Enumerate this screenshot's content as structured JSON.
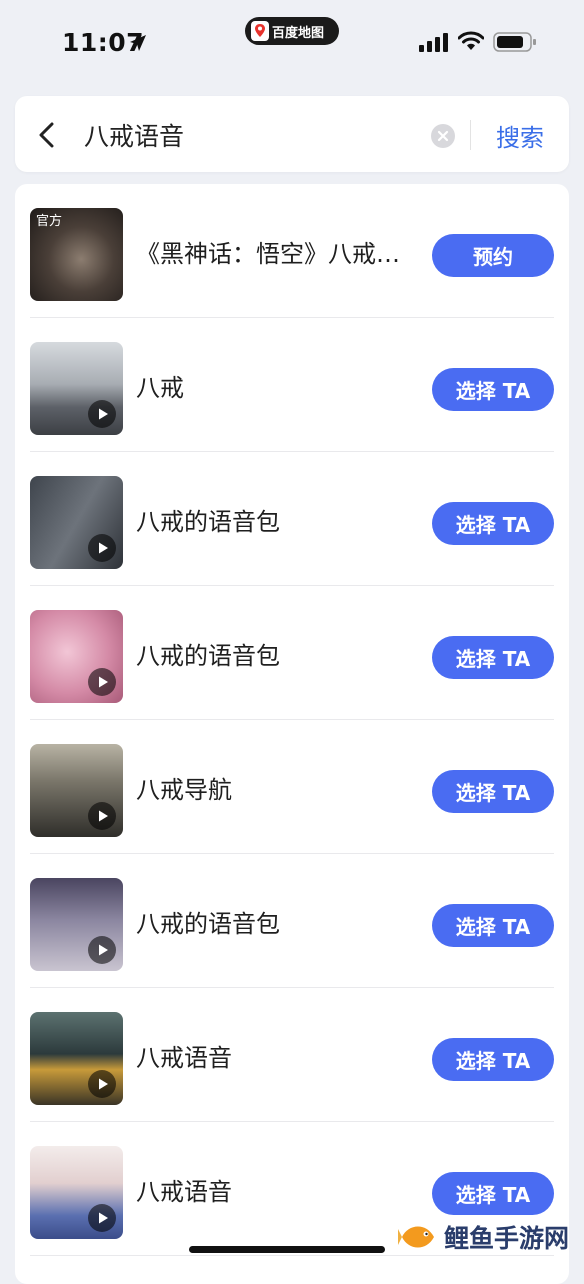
{
  "status_bar": {
    "time": "11:07",
    "app_pill_label": "百度地图"
  },
  "search": {
    "query": "八戒语音",
    "search_button_label": "搜索",
    "icons": [
      "back-icon",
      "clear-icon"
    ],
    "accent_color": "#3a6ee8"
  },
  "list": {
    "button_color": "#4a6cf2",
    "items": [
      {
        "title": "《黑神话：悟空》八戒语音",
        "button": "预约",
        "badge": "官方",
        "thumb_color": "#3a3430",
        "has_play": false
      },
      {
        "title": "八戒",
        "button": "选择 TA",
        "thumb_color": "#8a8f98",
        "has_play": true
      },
      {
        "title": "八戒的语音包",
        "button": "选择 TA",
        "thumb_color": "#5e6670",
        "has_play": true
      },
      {
        "title": "八戒的语音包",
        "button": "选择 TA",
        "thumb_color": "#d79ab3",
        "has_play": true
      },
      {
        "title": "八戒导航",
        "button": "选择 TA",
        "thumb_color": "#4a4c45",
        "has_play": true
      },
      {
        "title": "八戒的语音包",
        "button": "选择 TA",
        "thumb_color": "#6f6a86",
        "has_play": true
      },
      {
        "title": "八戒语音",
        "button": "选择 TA",
        "thumb_color": "#2f3a3c",
        "has_play": true
      },
      {
        "title": "八戒语音",
        "button": "选择 TA",
        "thumb_color": "#e3d7d5",
        "has_play": true
      }
    ]
  },
  "watermark": {
    "text": "鲤鱼手游网"
  }
}
